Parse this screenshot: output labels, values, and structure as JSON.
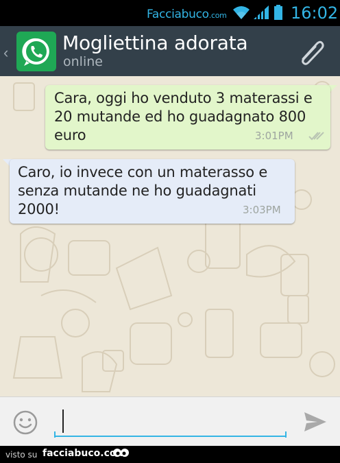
{
  "status_bar": {
    "brand": "Facciabuco",
    "brand_suffix": ".com",
    "time": "16:02",
    "icons": [
      "wifi-icon",
      "signal-icon",
      "battery-icon"
    ]
  },
  "header": {
    "back_glyph": "‹",
    "contact_name": "Mogliettina adorata",
    "contact_status": "online",
    "icons": [
      "whatsapp-logo-icon",
      "attach-paperclip-icon"
    ]
  },
  "messages": [
    {
      "direction": "outgoing",
      "text": "Cara, oggi ho venduto 3 materassi e 20 mutande ed ho guadagnato 800 euro",
      "time": "3:01PM",
      "status_icon": "double-check-icon"
    },
    {
      "direction": "incoming",
      "text": "Caro, io invece con un materasso e senza mutande ne ho guadagnati 2000!",
      "time": "3:03PM"
    }
  ],
  "composer": {
    "value": "",
    "icons": [
      "smiley-icon",
      "send-icon"
    ]
  },
  "footer": {
    "prefix": "visto su",
    "site": "facciabuco.com"
  },
  "colors": {
    "accent": "#33b5e5",
    "header_bg": "#33404a",
    "chat_bg": "#ede7d8",
    "outgoing_bubble": "#e2f6ca",
    "incoming_bubble": "#e5ecf8",
    "whatsapp_green": "#1fa855"
  }
}
